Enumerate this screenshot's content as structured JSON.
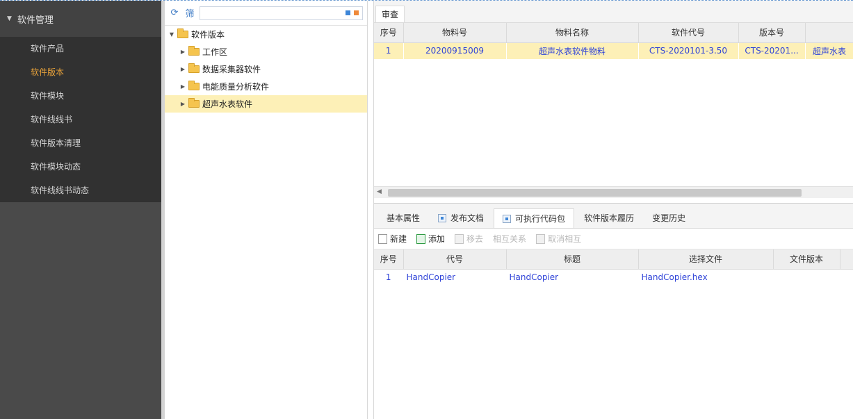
{
  "nav": {
    "group_label": "软件管理",
    "items": [
      {
        "label": "软件产品",
        "active": false
      },
      {
        "label": "软件版本",
        "active": true
      },
      {
        "label": "软件模块",
        "active": false
      },
      {
        "label": "软件线线书",
        "active": false
      },
      {
        "label": "软件版本清理",
        "active": false
      },
      {
        "label": "软件模块动态",
        "active": false
      },
      {
        "label": "软件线线书动态",
        "active": false
      }
    ]
  },
  "tree": {
    "toolbar": {
      "refresh_icon": "refresh-icon",
      "filter_label": "筛",
      "search_value": ""
    },
    "root": "软件版本",
    "children": [
      "工作区",
      "数据采集器软件",
      "电能质量分析软件",
      "超声水表软件"
    ]
  },
  "top_grid": {
    "tab_label": "审查",
    "columns": [
      "序号",
      "物料号",
      "物料名称",
      "软件代号",
      "版本号"
    ],
    "rows": [
      {
        "no": "1",
        "material_no": "20200915009",
        "material_name": "超声水表软件物料",
        "software_code": "CTS-2020101-3.50",
        "version": "CTS-20201...",
        "extra": "超声水表"
      }
    ]
  },
  "bottom": {
    "tabs": [
      {
        "label": "基本属性",
        "active": false,
        "icon": false
      },
      {
        "label": "发布文档",
        "active": false,
        "icon": true
      },
      {
        "label": "可执行代码包",
        "active": true,
        "icon": true
      },
      {
        "label": "软件版本履历",
        "active": false,
        "icon": false
      },
      {
        "label": "变更历史",
        "active": false,
        "icon": false
      }
    ],
    "toolbar": [
      {
        "label": "新建",
        "disabled": false
      },
      {
        "label": "添加",
        "disabled": false
      },
      {
        "label": "移去",
        "disabled": true
      },
      {
        "label": "相互关系",
        "disabled": true
      },
      {
        "label": "取消相互",
        "disabled": true
      }
    ],
    "columns": [
      "序号",
      "代号",
      "标题",
      "选择文件",
      "文件版本"
    ],
    "rows": [
      {
        "no": "1",
        "code": "HandCopier",
        "title": "HandCopier",
        "file": "HandCopier.hex",
        "file_version": ""
      }
    ]
  }
}
